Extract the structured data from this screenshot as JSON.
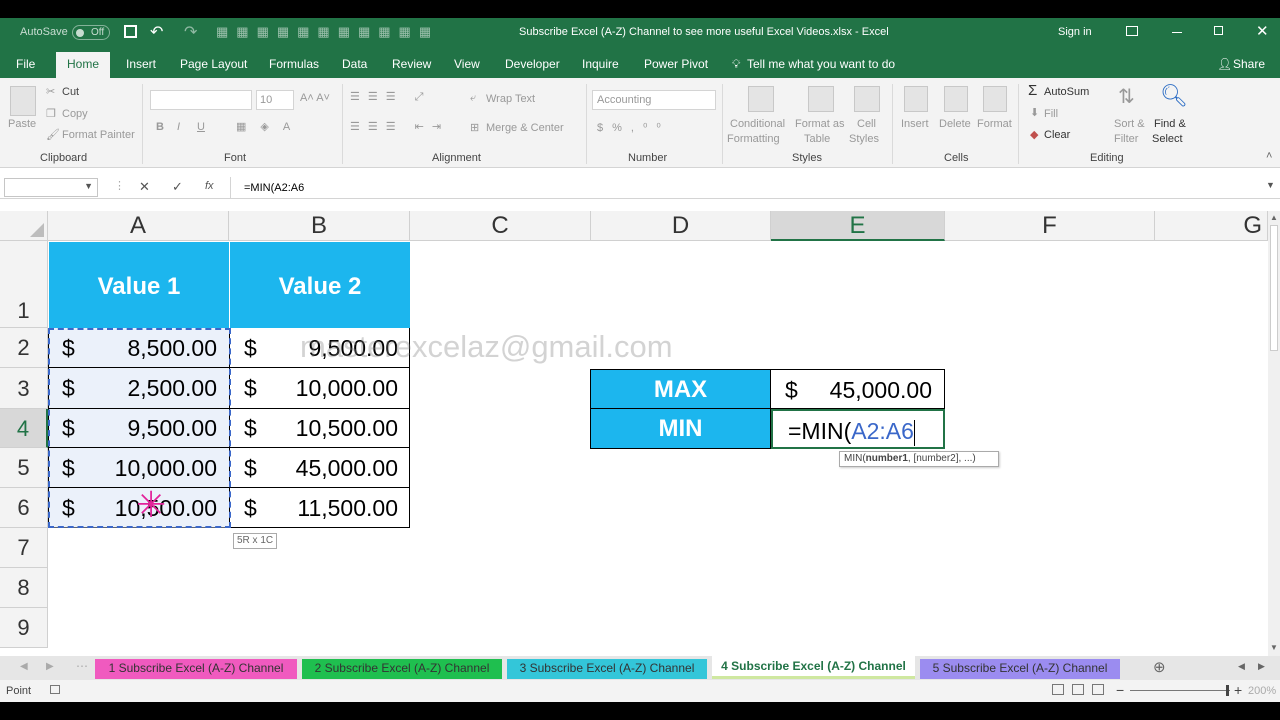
{
  "window": {
    "title": "Subscribe Excel (A-Z) Channel to see more useful Excel Videos.xlsx - Excel",
    "autosave": "AutoSave",
    "autosave_state": "Off",
    "signin": "Sign in"
  },
  "menu": {
    "file": "File",
    "home": "Home",
    "insert": "Insert",
    "page_layout": "Page Layout",
    "formulas": "Formulas",
    "data": "Data",
    "review": "Review",
    "view": "View",
    "developer": "Developer",
    "inquire": "Inquire",
    "power_pivot": "Power Pivot",
    "tell_me": "Tell me what you want to do",
    "share": "Share"
  },
  "ribbon": {
    "clipboard": {
      "label": "Clipboard",
      "paste": "Paste",
      "cut": "Cut",
      "copy": "Copy",
      "format_painter": "Format Painter"
    },
    "font": {
      "label": "Font",
      "size": "10",
      "bold": "B",
      "italic": "I",
      "underline": "U"
    },
    "alignment": {
      "label": "Alignment",
      "wrap": "Wrap Text",
      "merge": "Merge & Center"
    },
    "number": {
      "label": "Number",
      "format": "Accounting"
    },
    "styles": {
      "label": "Styles",
      "conditional1": "Conditional",
      "conditional2": "Formatting",
      "format_table1": "Format as",
      "format_table2": "Table",
      "cell_styles1": "Cell",
      "cell_styles2": "Styles"
    },
    "cells": {
      "label": "Cells",
      "insert": "Insert",
      "delete": "Delete",
      "format": "Format"
    },
    "editing": {
      "label": "Editing",
      "autosum": "AutoSum",
      "fill": "Fill",
      "clear": "Clear",
      "sort1": "Sort &",
      "sort2": "Filter",
      "find1": "Find &",
      "find2": "Select"
    }
  },
  "formula_bar": {
    "name_box": "",
    "formula": "=MIN(A2:A6",
    "fx": "fx"
  },
  "columns": [
    "A",
    "B",
    "C",
    "D",
    "E",
    "F",
    "G"
  ],
  "rows": [
    "1",
    "2",
    "3",
    "4",
    "5",
    "6",
    "7",
    "8",
    "9"
  ],
  "table": {
    "headers": [
      "Value 1",
      "Value 2"
    ],
    "currency": "$",
    "value1": [
      "8,500.00",
      "2,500.00",
      "9,500.00",
      "10,000.00",
      "10,500.00"
    ],
    "value2": [
      "9,500.00",
      "10,000.00",
      "10,500.00",
      "45,000.00",
      "11,500.00"
    ]
  },
  "watermark": "masterexcelaz@gmail.com",
  "summary": {
    "max_label": "MAX",
    "max_currency": "$",
    "max_value": "45,000.00",
    "min_label": "MIN",
    "min_formula_prefix": "=MIN(",
    "min_formula_ref": "A2:A6"
  },
  "tooltip": {
    "fn": "MIN(",
    "arg_bold": "number1",
    "rest": ", [number2], ...)"
  },
  "selection_size": "5R x 1C",
  "sheets": [
    {
      "label": "1 Subscribe Excel (A-Z) Channel",
      "color": "#f05abf"
    },
    {
      "label": "2 Subscribe Excel (A-Z) Channel",
      "color": "#1fbf4f"
    },
    {
      "label": "3 Subscribe Excel (A-Z) Channel",
      "color": "#33c6d9"
    },
    {
      "label": "4 Subscribe Excel (A-Z) Channel",
      "color": "#ffffff"
    },
    {
      "label": "5 Subscribe Excel (A-Z) Channel",
      "color": "#9b8cf0"
    }
  ],
  "status": {
    "mode": "Point",
    "zoom": "200%"
  },
  "colors": {
    "excel_green": "#217346",
    "header_blue": "#1cb6ee",
    "ref_blue": "#3a67c9"
  }
}
